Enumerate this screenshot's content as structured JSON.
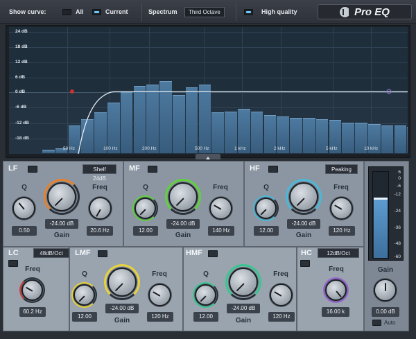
{
  "topbar": {
    "show_curve_label": "Show curve:",
    "all_label": "All",
    "all_on": false,
    "current_label": "Current",
    "current_on": true,
    "spectrum_label": "Spectrum",
    "spectrum_value": "Third Octave",
    "high_quality_label": "High quality",
    "high_quality_on": true,
    "logo_text": "Pro EQ"
  },
  "graph": {
    "y_labels": [
      "24 dB",
      "18 dB",
      "12 dB",
      "6 dB",
      "0 dB",
      "-6 dB",
      "-12 dB",
      "-18 dB"
    ],
    "x_labels": [
      "50 Hz",
      "100 Hz",
      "200 Hz",
      "500 Hz",
      "1 kHz",
      "2 kHz",
      "5 kHz",
      "10 kHz"
    ],
    "spectrum_bars": [
      0.03,
      0.04,
      0.22,
      0.27,
      0.32,
      0.4,
      0.48,
      0.53,
      0.54,
      0.57,
      0.46,
      0.52,
      0.54,
      0.32,
      0.33,
      0.35,
      0.33,
      0.3,
      0.29,
      0.28,
      0.28,
      0.27,
      0.26,
      0.24,
      0.24,
      0.23,
      0.22,
      0.22,
      0.21,
      0.2,
      0.19,
      0.18
    ]
  },
  "bands": {
    "lf": {
      "title": "LF",
      "mode": "Shelf 24dB",
      "q_label": "Q",
      "q_value": "0.50",
      "gain_label": "Gain",
      "gain_value": "-24.00 dB",
      "freq_label": "Freq",
      "freq_value": "20.6 Hz",
      "color": "#e8802a"
    },
    "mf": {
      "title": "MF",
      "q_label": "Q",
      "q_value": "12.00",
      "gain_label": "Gain",
      "gain_value": "-24.00 dB",
      "freq_label": "Freq",
      "freq_value": "140 Hz",
      "color": "#5fd13a"
    },
    "hf": {
      "title": "HF",
      "mode": "Peaking",
      "q_label": "Q",
      "q_value": "12.00",
      "gain_label": "Gain",
      "gain_value": "-24.00 dB",
      "freq_label": "Freq",
      "freq_value": "120 Hz",
      "color": "#4ab8d8"
    },
    "lc": {
      "title": "LC",
      "mode": "48dB/Oct",
      "freq_label": "Freq",
      "freq_value": "60.2 Hz",
      "color": "#d23a3a"
    },
    "lmf": {
      "title": "LMF",
      "q_label": "Q",
      "q_value": "12.00",
      "gain_label": "Gain",
      "gain_value": "-24.00 dB",
      "freq_label": "Freq",
      "freq_value": "120 Hz",
      "color": "#e6d23a"
    },
    "hmf": {
      "title": "HMF",
      "q_label": "Q",
      "q_value": "12.00",
      "gain_label": "Gain",
      "gain_value": "-24.00 dB",
      "freq_label": "Freq",
      "freq_value": "120 Hz",
      "color": "#38c690"
    },
    "hc": {
      "title": "HC",
      "mode": "12dB/Oct",
      "freq_label": "Freq",
      "freq_value": "16.00 k",
      "color": "#9a62d6"
    }
  },
  "output": {
    "meter_labels": [
      "6",
      "0",
      "-6",
      "-12",
      "-24",
      "-36",
      "-48",
      "-60"
    ],
    "meter_level": 0.68,
    "gain_label": "Gain",
    "gain_value": "0.00 dB",
    "auto_label": "Auto"
  }
}
